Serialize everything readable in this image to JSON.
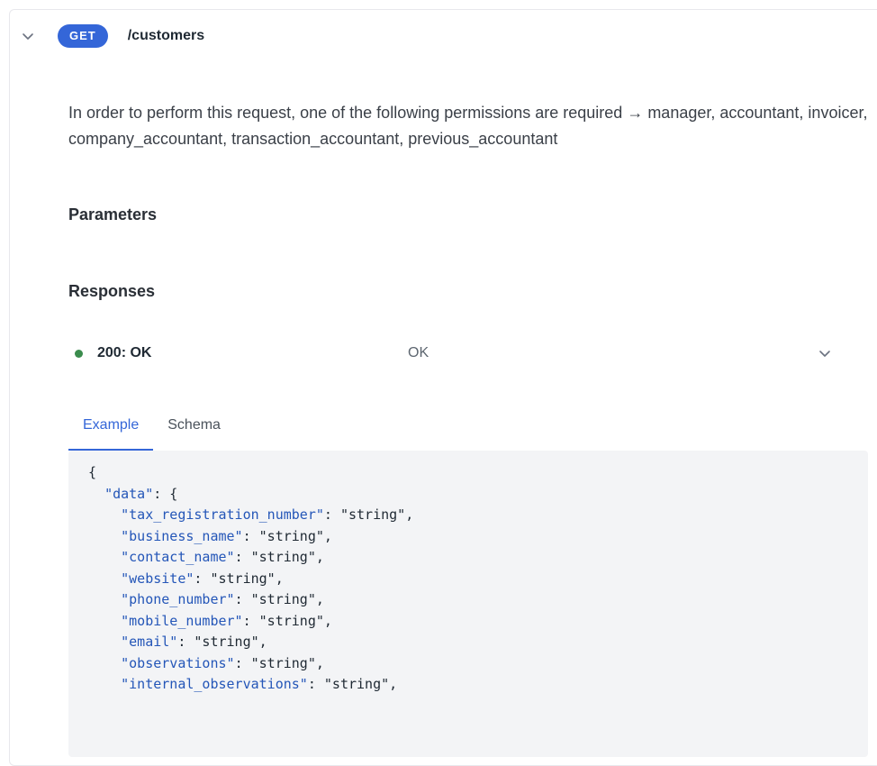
{
  "endpoint": {
    "method": "GET",
    "path": "/customers"
  },
  "description": "In order to perform this request, one of the following permissions are required → manager, accountant, invoicer, company_accountant, transaction_accountant, previous_accountant",
  "sections": {
    "parameters_title": "Parameters",
    "responses_title": "Responses"
  },
  "response": {
    "code": "200: OK",
    "status_text": "OK",
    "status_color": "#3b8c4d"
  },
  "tabs": [
    {
      "label": "Example",
      "active": true
    },
    {
      "label": "Schema",
      "active": false
    }
  ],
  "example": {
    "open_brace": "{",
    "data_key": "\"data\"",
    "data_open": ": {",
    "fields": [
      {
        "key": "\"tax_registration_number\"",
        "value": "\"string\""
      },
      {
        "key": "\"business_name\"",
        "value": "\"string\""
      },
      {
        "key": "\"contact_name\"",
        "value": "\"string\""
      },
      {
        "key": "\"website\"",
        "value": "\"string\""
      },
      {
        "key": "\"phone_number\"",
        "value": "\"string\""
      },
      {
        "key": "\"mobile_number\"",
        "value": "\"string\""
      },
      {
        "key": "\"email\"",
        "value": "\"string\""
      },
      {
        "key": "\"observations\"",
        "value": "\"string\""
      },
      {
        "key": "\"internal_observations\"",
        "value": "\"string\""
      }
    ]
  },
  "colors": {
    "accent": "#3466d8",
    "json_key": "#2456b8"
  },
  "icons": {
    "collapse": "chevron-down-icon",
    "expand_response": "chevron-down-icon"
  }
}
